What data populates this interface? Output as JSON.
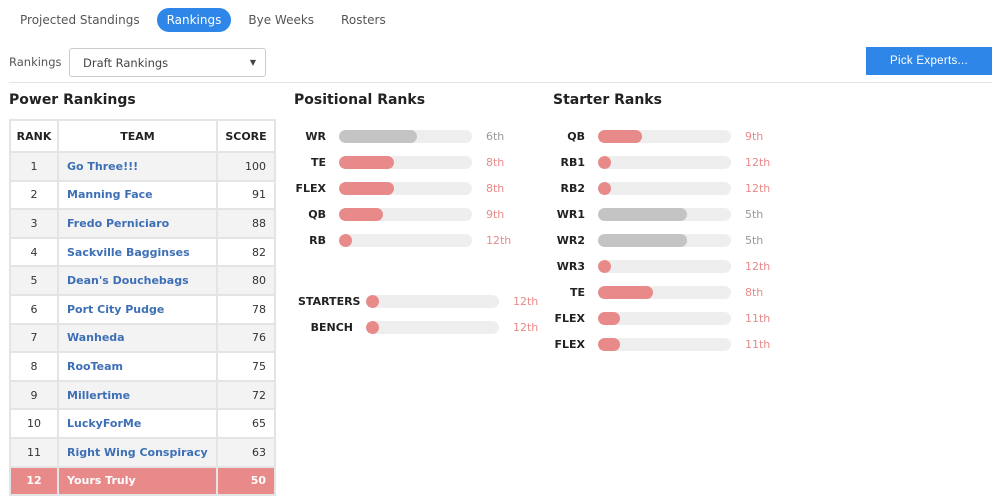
{
  "tabs": [
    {
      "label": "Projected Standings",
      "active": false
    },
    {
      "label": "Rankings",
      "active": true
    },
    {
      "label": "Bye Weeks",
      "active": false
    },
    {
      "label": "Rosters",
      "active": false
    }
  ],
  "toolbar": {
    "rankings_label": "Rankings",
    "rankings_select_value": "Draft Rankings",
    "pick_experts_label": "Pick Experts..."
  },
  "colors": {
    "accent": "#2e86e8",
    "bad": "#e88a8a",
    "neutral": "#c4c4c4",
    "link": "#3d6fb6"
  },
  "power_rankings": {
    "title": "Power Rankings",
    "headers": {
      "rank": "RANK",
      "team": "TEAM",
      "score": "SCORE"
    },
    "rows": [
      {
        "rank": "1",
        "team": "Go Three!!!",
        "score": "100"
      },
      {
        "rank": "2",
        "team": "Manning Face",
        "score": "91"
      },
      {
        "rank": "3",
        "team": "Fredo Perniciaro",
        "score": "88"
      },
      {
        "rank": "4",
        "team": "Sackville Bagginses",
        "score": "82"
      },
      {
        "rank": "5",
        "team": "Dean's Douchebags",
        "score": "80"
      },
      {
        "rank": "6",
        "team": "Port City Pudge",
        "score": "78"
      },
      {
        "rank": "7",
        "team": "Wanheda",
        "score": "76"
      },
      {
        "rank": "8",
        "team": "RooTeam",
        "score": "75"
      },
      {
        "rank": "9",
        "team": "Millertime",
        "score": "72"
      },
      {
        "rank": "10",
        "team": "LuckyForMe",
        "score": "65"
      },
      {
        "rank": "11",
        "team": "Right Wing Conspiracy",
        "score": "63"
      },
      {
        "rank": "12",
        "team": "Yours Truly",
        "score": "50",
        "highlight": true
      }
    ]
  },
  "positional_ranks": {
    "title": "Positional Ranks",
    "total_teams": 12,
    "groups": [
      [
        {
          "label": "WR",
          "rank": 6,
          "rank_text": "6th"
        },
        {
          "label": "TE",
          "rank": 8,
          "rank_text": "8th"
        },
        {
          "label": "FLEX",
          "rank": 8,
          "rank_text": "8th"
        },
        {
          "label": "QB",
          "rank": 9,
          "rank_text": "9th"
        },
        {
          "label": "RB",
          "rank": 12,
          "rank_text": "12th"
        }
      ],
      [
        {
          "label": "STARTERS",
          "rank": 12,
          "rank_text": "12th"
        },
        {
          "label": "BENCH",
          "rank": 12,
          "rank_text": "12th"
        }
      ]
    ]
  },
  "starter_ranks": {
    "title": "Starter Ranks",
    "total_teams": 12,
    "items": [
      {
        "label": "QB",
        "rank": 9,
        "rank_text": "9th"
      },
      {
        "label": "RB1",
        "rank": 12,
        "rank_text": "12th"
      },
      {
        "label": "RB2",
        "rank": 12,
        "rank_text": "12th"
      },
      {
        "label": "WR1",
        "rank": 5,
        "rank_text": "5th"
      },
      {
        "label": "WR2",
        "rank": 5,
        "rank_text": "5th"
      },
      {
        "label": "WR3",
        "rank": 12,
        "rank_text": "12th"
      },
      {
        "label": "TE",
        "rank": 8,
        "rank_text": "8th"
      },
      {
        "label": "FLEX",
        "rank": 11,
        "rank_text": "11th"
      },
      {
        "label": "FLEX",
        "rank": 11,
        "rank_text": "11th"
      }
    ]
  }
}
